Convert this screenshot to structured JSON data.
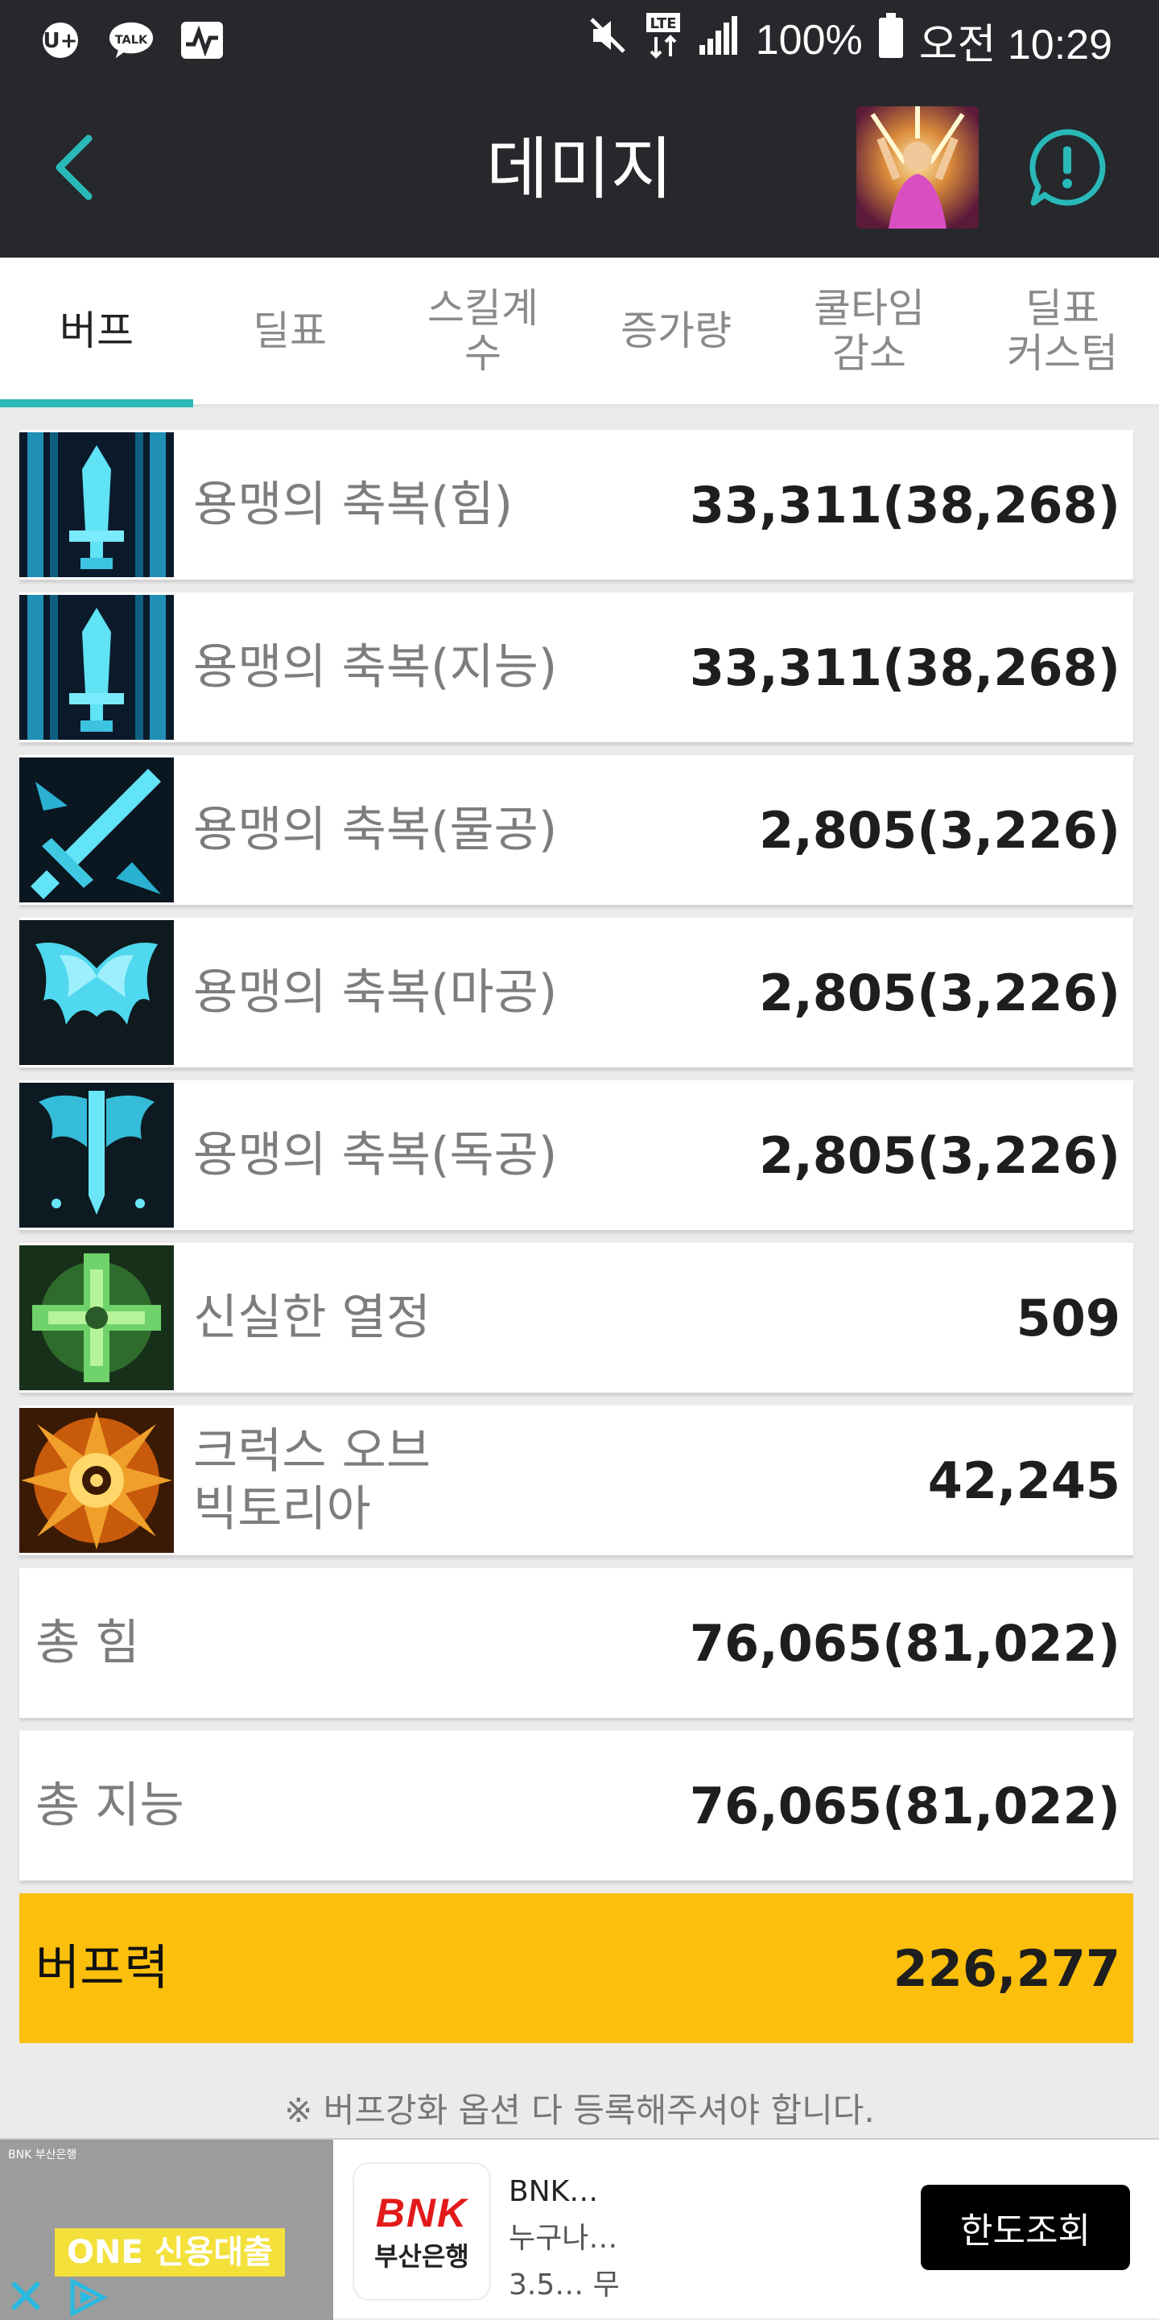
{
  "status_bar": {
    "left_icons": [
      "u-plus-icon",
      "kakaotalk-icon",
      "activity-icon"
    ],
    "kakao_label": "TALK",
    "lte_label": "LTE",
    "battery": "100%",
    "time": "오전 10:29"
  },
  "app_bar": {
    "title": "데미지"
  },
  "tabs": [
    {
      "label": "버프",
      "active": true
    },
    {
      "label": "딜표",
      "active": false
    },
    {
      "label": "스킬계\n수",
      "active": false
    },
    {
      "label": "증가량",
      "active": false
    },
    {
      "label": "쿨타임\n감소",
      "active": false
    },
    {
      "label": "딜표\n커스텀",
      "active": false
    }
  ],
  "buff_rows": [
    {
      "label": "용맹의 축복(힘)",
      "value": "33,311(38,268)",
      "icon": "sword-icon"
    },
    {
      "label": "용맹의 축복(지능)",
      "value": "33,311(38,268)",
      "icon": "sword-icon"
    },
    {
      "label": "용맹의 축복(물공)",
      "value": "2,805(3,226)",
      "icon": "slash-sword-icon"
    },
    {
      "label": "용맹의 축복(마공)",
      "value": "2,805(3,226)",
      "icon": "wings-icon"
    },
    {
      "label": "용맹의 축복(독공)",
      "value": "2,805(3,226)",
      "icon": "winged-sword-icon"
    },
    {
      "label": "신실한 열정",
      "value": "509",
      "icon": "green-cross-icon"
    },
    {
      "label": "크럭스 오브\n빅토리아",
      "value": "42,245",
      "icon": "orange-sun-icon"
    }
  ],
  "totals": [
    {
      "label": "총 힘",
      "value": "76,065(81,022)"
    },
    {
      "label": "총 지능",
      "value": "76,065(81,022)"
    }
  ],
  "buff_power": {
    "label": "버프력",
    "value": "226,277"
  },
  "notice": "※ 버프강화 옵션 다 등록해주셔야 합니다.",
  "ad": {
    "tiny_header": "BNK 부산은행",
    "banner": "ONE 신용대출",
    "brand": "BNK",
    "brand_sub": "부산은행",
    "title": "BNK…",
    "line2": "누구나…",
    "line3": "3.5… 무",
    "cta": "한도조회"
  },
  "colors": {
    "bar_bg": "#26282c",
    "accent": "#2ab9b9",
    "power_bg": "#fcbf0b"
  }
}
